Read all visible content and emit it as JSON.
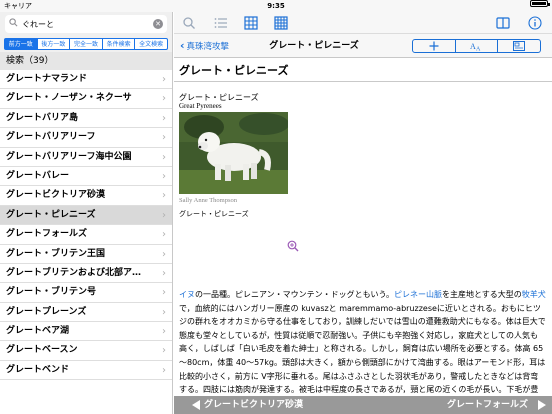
{
  "status": {
    "carrier": "キャリア",
    "time": "9:35",
    "battery_level": 1.0
  },
  "search": {
    "value": "ぐれーと"
  },
  "modes": [
    {
      "label": "前方一致",
      "active": true
    },
    {
      "label": "後方一致",
      "active": false
    },
    {
      "label": "完全一致",
      "active": false
    },
    {
      "label": "条件検索",
      "active": false
    },
    {
      "label": "全文検索",
      "active": false
    }
  ],
  "results": {
    "header": "検索（39）",
    "items": [
      "グレートナマランド",
      "グレート・ノーザン・ネクーサ",
      "グレートバリア島",
      "グレートバリアリーフ",
      "グレートバリアリーフ海中公園",
      "グレートバレー",
      "グレートビクトリア砂漠",
      "グレート・ピレニーズ",
      "グレートフォールズ",
      "グレート・ブリテン王国",
      "グレートブリテンおよび北部ア…",
      "グレート・ブリテン号",
      "グレートプレーンズ",
      "グレートベア湖",
      "グレートベースン",
      "グレートベンド"
    ],
    "selected_index": 7
  },
  "nav": {
    "back_label": "真珠湾攻撃",
    "title": "グレート・ピレニーズ"
  },
  "entry": {
    "title": "グレート・ピレニーズ",
    "headword_ja": "グレート・ピレニーズ",
    "headword_en": "Great Pyrenees",
    "photo_credit": "Sally Anne Thompson",
    "caption": "グレート・ピレニーズ",
    "body": [
      {
        "t": "イヌ",
        "link": true
      },
      {
        "t": "の一品種。ピレニアン・マウンテン・ドッグともいう。",
        "link": false
      },
      {
        "t": "ピレネー山脈",
        "link": true
      },
      {
        "t": "を主産地とする大型の",
        "link": false
      },
      {
        "t": "牧羊犬",
        "link": true
      },
      {
        "t": "で，血統的にはハンガリー原産の kuvaszと maremmamo-abruzzeseに近いとされる。おもにヒツジの群れをオオカミから守る仕事をしており，訓練しだいでは雪山の遭難救助犬にもなる。体は巨大で態度も堂々としているが，性質は従順で忍耐強い。子供にも辛抱強く対応し，家庭犬としての人気も高く，しばしば「白い毛皮を着た紳士」と称される。しかし，飼育は広い場所を必要とする。体高 65～80cm，体重 40～57kg。頭部は大きく，額から側頭部にかけて湾曲する。眼はアーモンド形，耳は比較的小さく，前方に V字形に垂れる。尾はふさふさとした羽状毛があり，警戒したときなどは背弯する。四肢には筋肉が発達する。被毛は中程度の長さであるが，頸と尾の近くの毛が長い。下毛が豊富。毛色は白，もしくは白色地に褐色の斑がある。頸，耳，尾に分布する。",
        "link": false
      }
    ]
  },
  "bottom": {
    "prev": "グレートビクトリア砂漠",
    "next": "グレートフォールズ"
  },
  "colors": {
    "accent": "#1a6fd6",
    "selected_row": "#d9d9d9",
    "bottom_bar": "#999999"
  }
}
